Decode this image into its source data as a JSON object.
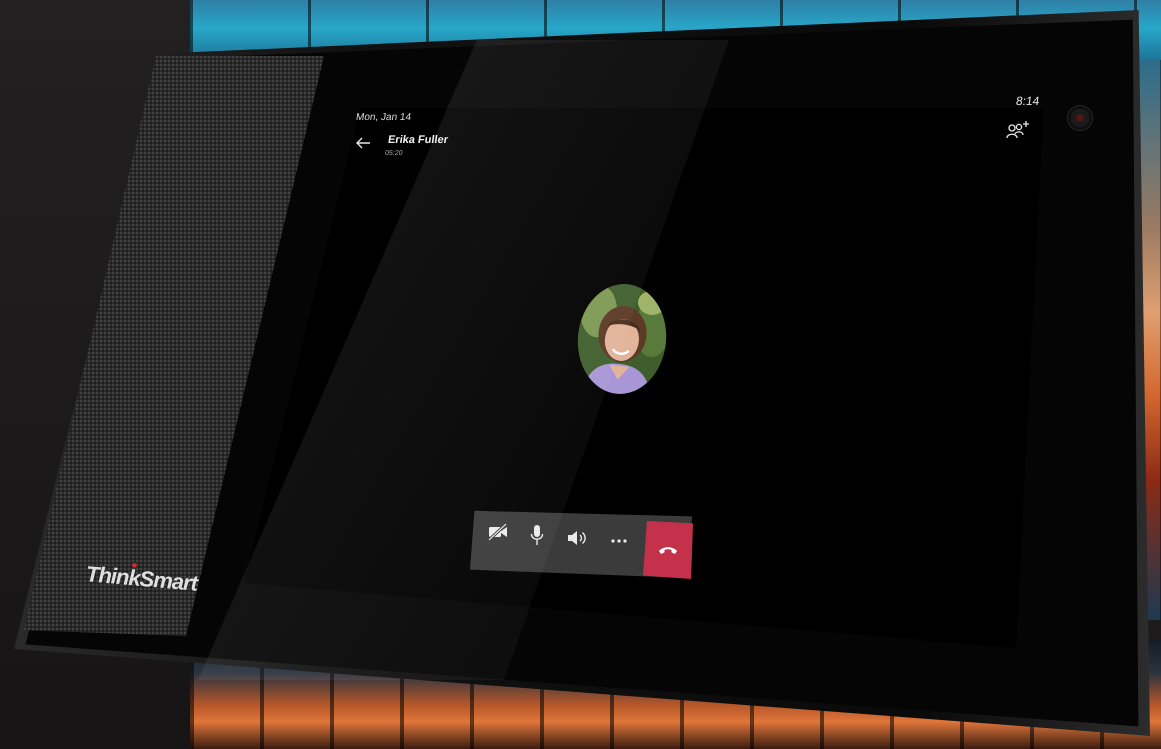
{
  "device": {
    "brand": "ThinkSmart"
  },
  "status_bar": {
    "date": "Mon, Jan 14",
    "time": "8:14"
  },
  "call": {
    "caller_name": "Erika Fuller",
    "duration": "05:20"
  },
  "icons": {
    "back": "arrow-left-icon",
    "add_people": "add-people-icon",
    "camera_off": "video-off-icon",
    "microphone": "microphone-icon",
    "speaker": "speaker-icon",
    "more": "more-options-icon",
    "hang_up": "phone-hangup-icon"
  },
  "colors": {
    "hangup_red": "#c4314b",
    "control_bar": "#3b3b3b",
    "brand_red_dot": "#e1261c"
  }
}
